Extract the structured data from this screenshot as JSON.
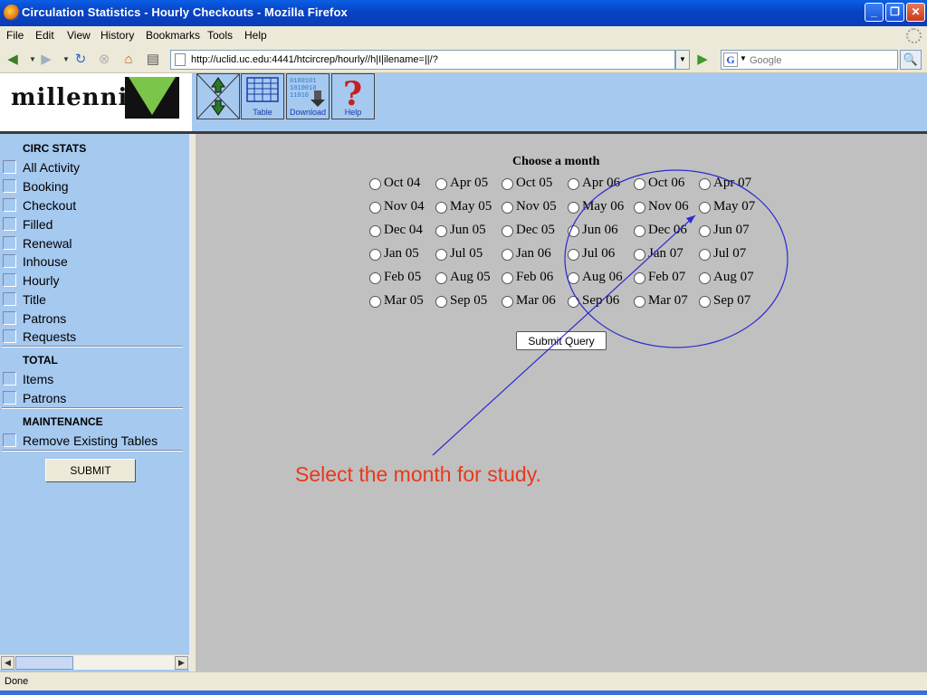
{
  "window": {
    "title": "Circulation Statistics - Hourly Checkouts - Mozilla Firefox"
  },
  "menu": [
    "File",
    "Edit",
    "View",
    "History",
    "Bookmarks",
    "Tools",
    "Help"
  ],
  "nav": {
    "url": "http://uclid.uc.edu:4441/htcircrep/hourly//h|I|ilename=||/?",
    "search_placeholder": "Google",
    "search_engine_letter": "G"
  },
  "banner": {
    "logo_text": "millennium",
    "toolbar": [
      {
        "name": "nav-arrows",
        "label": ""
      },
      {
        "name": "table",
        "label": "Table"
      },
      {
        "name": "download",
        "label": "Download"
      },
      {
        "name": "help",
        "label": "Help"
      }
    ]
  },
  "sidebar": {
    "circ_title": "CIRC STATS",
    "circ_items": [
      "All Activity",
      "Booking",
      "Checkout",
      "Filled",
      "Renewal",
      "Inhouse",
      "Hourly",
      "Title",
      "Patrons",
      "Requests"
    ],
    "total_title": "TOTAL",
    "total_items": [
      "Items",
      "Patrons"
    ],
    "maint_title": "MAINTENANCE",
    "maint_items": [
      "Remove Existing Tables"
    ],
    "submit_label": "SUBMIT"
  },
  "main": {
    "heading": "Choose a month",
    "months": [
      [
        "Oct 04",
        "Apr 05",
        "Oct 05",
        "Apr 06",
        "Oct 06",
        "Apr 07"
      ],
      [
        "Nov 04",
        "May 05",
        "Nov 05",
        "May 06",
        "Nov 06",
        "May 07"
      ],
      [
        "Dec 04",
        "Jun 05",
        "Dec 05",
        "Jun 06",
        "Dec 06",
        "Jun 07"
      ],
      [
        "Jan 05",
        "Jul 05",
        "Jan 06",
        "Jul 06",
        "Jan 07",
        "Jul 07"
      ],
      [
        "Feb 05",
        "Aug 05",
        "Feb 06",
        "Aug 06",
        "Feb 07",
        "Aug 07"
      ],
      [
        "Mar 05",
        "Sep 05",
        "Mar 06",
        "Sep 06",
        "Mar 07",
        "Sep 07"
      ]
    ],
    "submit_query_label": "Submit Query",
    "annotation_text": "Select the month for study.",
    "annotation_color": "#e8391b",
    "callout_color": "#2a2ad0"
  },
  "status": {
    "text": "Done"
  }
}
